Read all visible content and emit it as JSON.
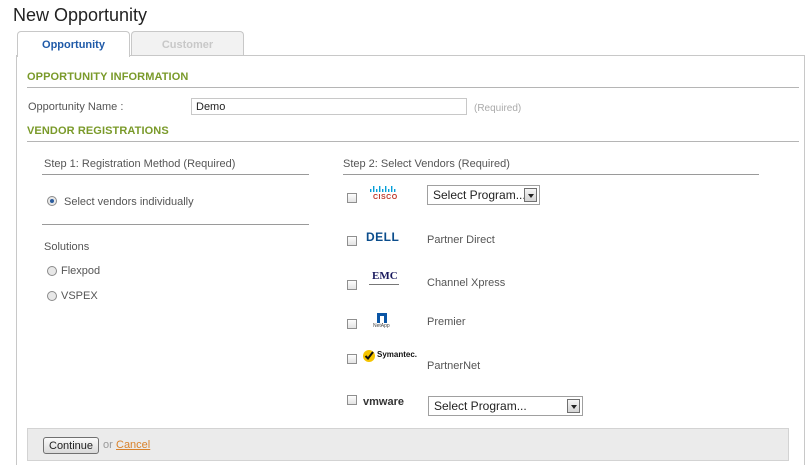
{
  "page": {
    "title": "New Opportunity"
  },
  "tabs": [
    {
      "label": "Opportunity",
      "active": true
    },
    {
      "label": "Customer",
      "active": false
    }
  ],
  "opportunity_info": {
    "heading": "OPPORTUNITY INFORMATION",
    "name_label": "Opportunity Name :",
    "name_value": "Demo",
    "required_note": "(Required)"
  },
  "vendor_registrations": {
    "heading": "VENDOR REGISTRATIONS",
    "step1": {
      "title": "Step 1: Registration Method (Required)",
      "method_option": "Select vendors individually",
      "method_selected": true,
      "solutions_label": "Solutions",
      "solutions": [
        {
          "label": "Flexpod",
          "selected": false
        },
        {
          "label": "VSPEX",
          "selected": false
        }
      ]
    },
    "step2": {
      "title": "Step 2: Select Vendors (Required)",
      "vendors": [
        {
          "logo": "cisco-logo",
          "brand_text": "CISCO",
          "program_select": "Select Program...",
          "checked": false
        },
        {
          "logo": "dell-logo",
          "brand_text": "DELL",
          "program": "Partner Direct",
          "checked": false
        },
        {
          "logo": "emc-logo",
          "brand_text": "EMC",
          "program": "Channel Xpress",
          "checked": false
        },
        {
          "logo": "netapp-logo",
          "brand_text": "NetApp",
          "program": "Premier",
          "checked": false
        },
        {
          "logo": "symantec-logo",
          "brand_text": "Symantec.",
          "program": "PartnerNet",
          "checked": false
        },
        {
          "logo": "vmware-logo",
          "brand_text": "vmware",
          "program_select": "Select Program...",
          "checked": false
        }
      ]
    }
  },
  "footer": {
    "continue_label": "Continue",
    "or_text": "or",
    "cancel_label": "Cancel"
  },
  "colors": {
    "section_heading": "#7a9a2a",
    "active_tab": "#1f5aa8",
    "link": "#d9822b"
  }
}
